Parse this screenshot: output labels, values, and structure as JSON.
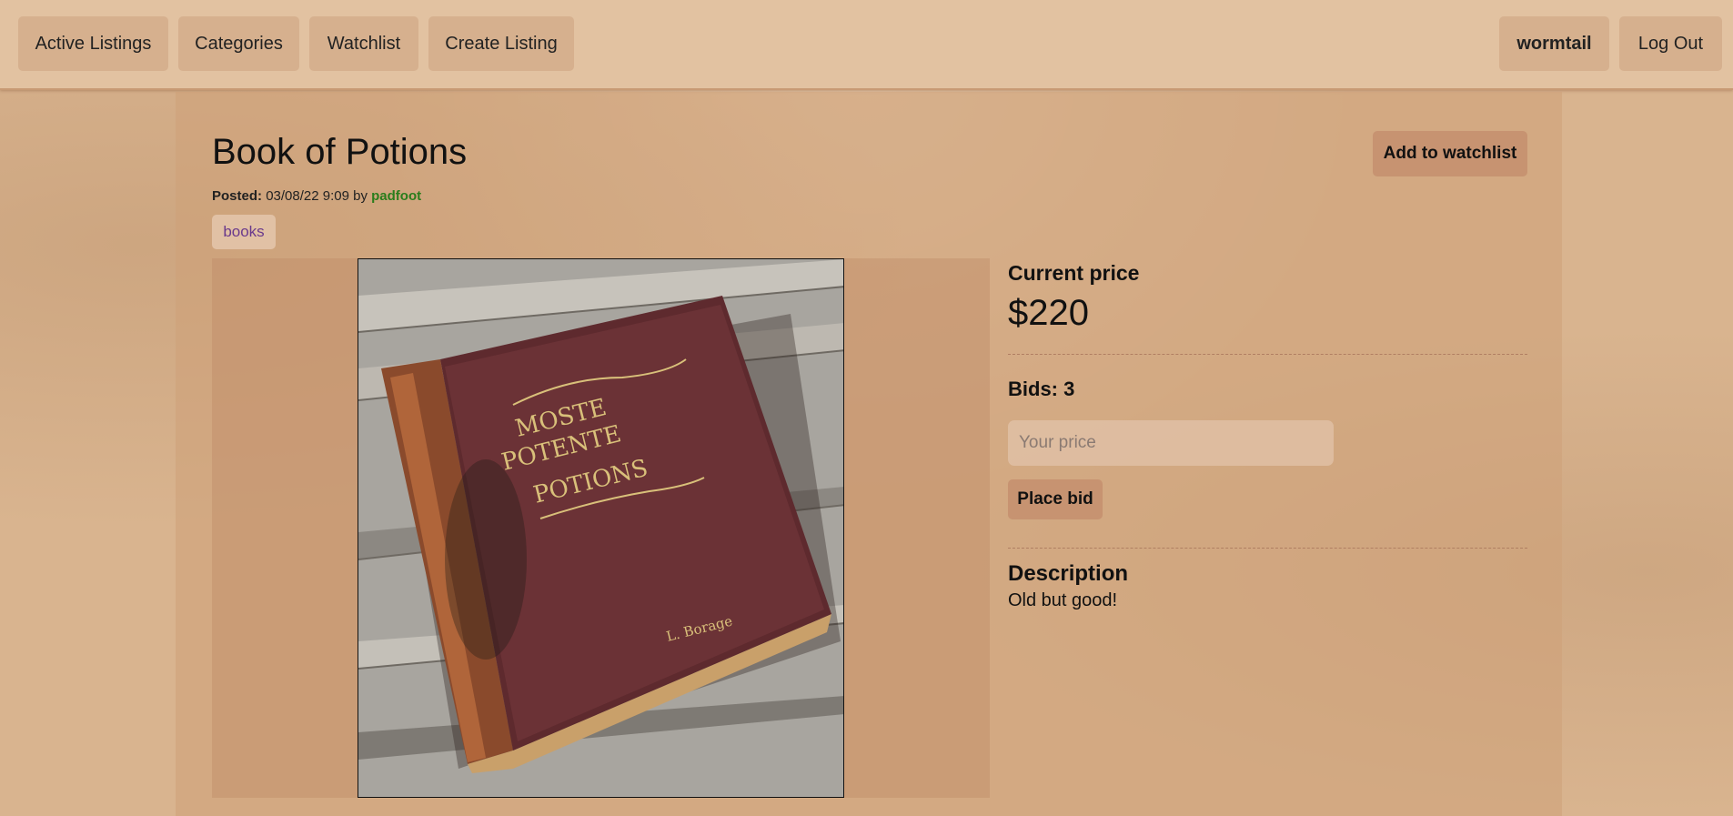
{
  "nav": {
    "left": [
      "Active Listings",
      "Categories",
      "Watchlist",
      "Create Listing"
    ],
    "username": "wormtail",
    "logout": "Log Out"
  },
  "listing": {
    "title": "Book of Potions",
    "posted_label": "Posted:",
    "posted_date": "03/08/22 9:09",
    "by": "by",
    "author": "padfoot",
    "category": "books",
    "watchlist_button": "Add to watchlist",
    "image_alt": "old leather book with gold title",
    "cover_lines": [
      "MOSTE",
      "POTENTE",
      "POTIONS"
    ],
    "cover_author": "L. Borage"
  },
  "bidding": {
    "current_price_label": "Current price",
    "current_price": "$220",
    "bids_label": "Bids: 3",
    "input_placeholder": "Your price",
    "place_bid": "Place bid"
  },
  "description": {
    "label": "Description",
    "text": "Old but good!"
  },
  "colors": {
    "background": "#d9b48f",
    "author_link": "#2a7d1c",
    "category_link": "#6a3a8c"
  }
}
